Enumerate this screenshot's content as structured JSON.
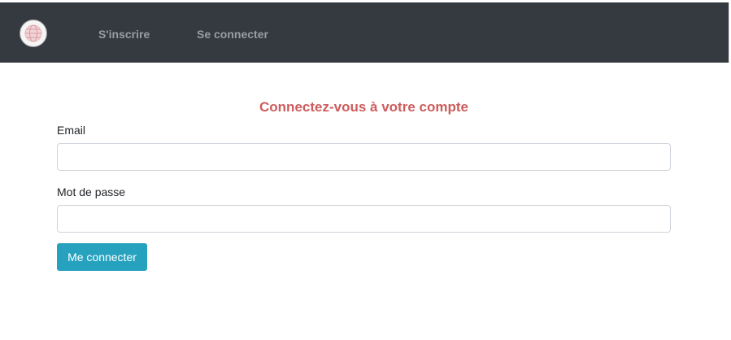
{
  "navbar": {
    "logo_icon": "globe-icon",
    "links": [
      {
        "label": "S'inscrire"
      },
      {
        "label": "Se connecter"
      }
    ],
    "background": "#343a40"
  },
  "login_form": {
    "title": "Connectez-vous à votre compte",
    "title_color": "#cd5c5c",
    "email_label": "Email",
    "email_value": "",
    "password_label": "Mot de passe",
    "password_value": "",
    "submit_label": "Me connecter",
    "submit_color": "#26a2bf"
  }
}
